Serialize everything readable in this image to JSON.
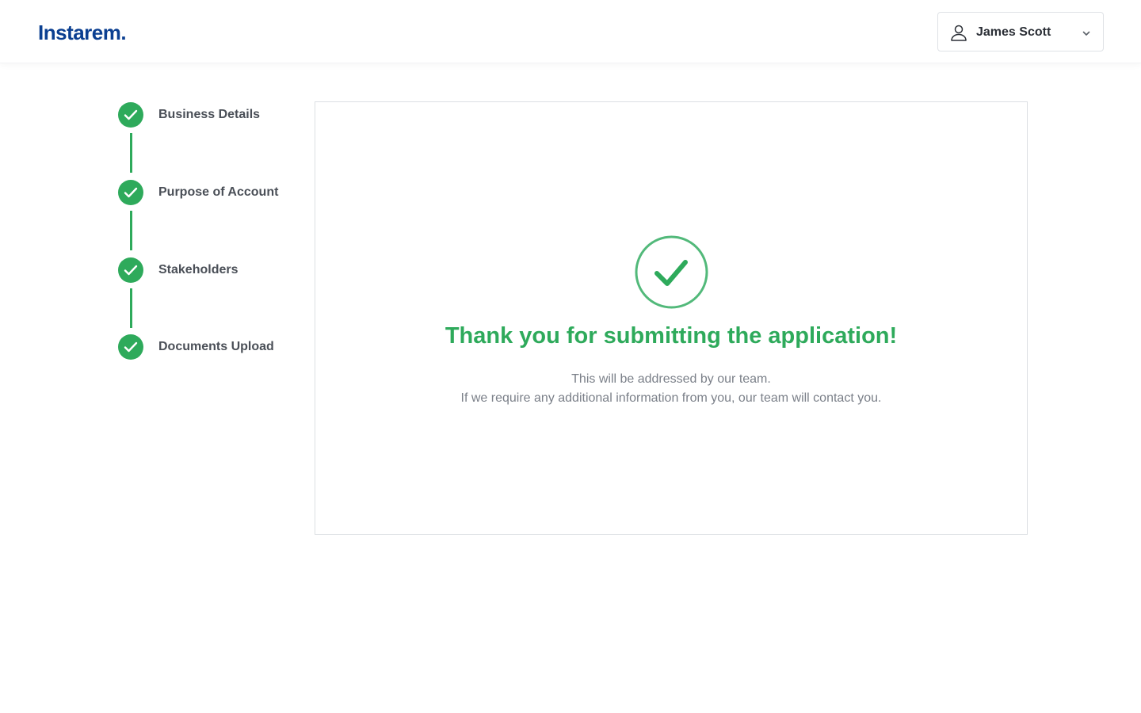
{
  "header": {
    "logo_text": "Instarem.",
    "user_name": "James Scott"
  },
  "stepper": {
    "steps": [
      {
        "label": "Business Details",
        "status": "completed"
      },
      {
        "label": "Purpose of Account",
        "status": "completed"
      },
      {
        "label": "Stakeholders",
        "status": "completed"
      },
      {
        "label": "Documents Upload",
        "status": "completed"
      }
    ]
  },
  "confirmation": {
    "title": "Thank you for submitting the application!",
    "line1": "This will be addressed by our team.",
    "line2": "If we require any additional information from you, our team will contact you."
  },
  "colors": {
    "brand": "#0b3f91",
    "success": "#2eaa5b",
    "text_muted": "#7b8089"
  },
  "icons": {
    "user": "user-icon",
    "chevron": "chevron-down-icon",
    "step_check": "check-icon",
    "success": "success-check-circle-icon"
  }
}
